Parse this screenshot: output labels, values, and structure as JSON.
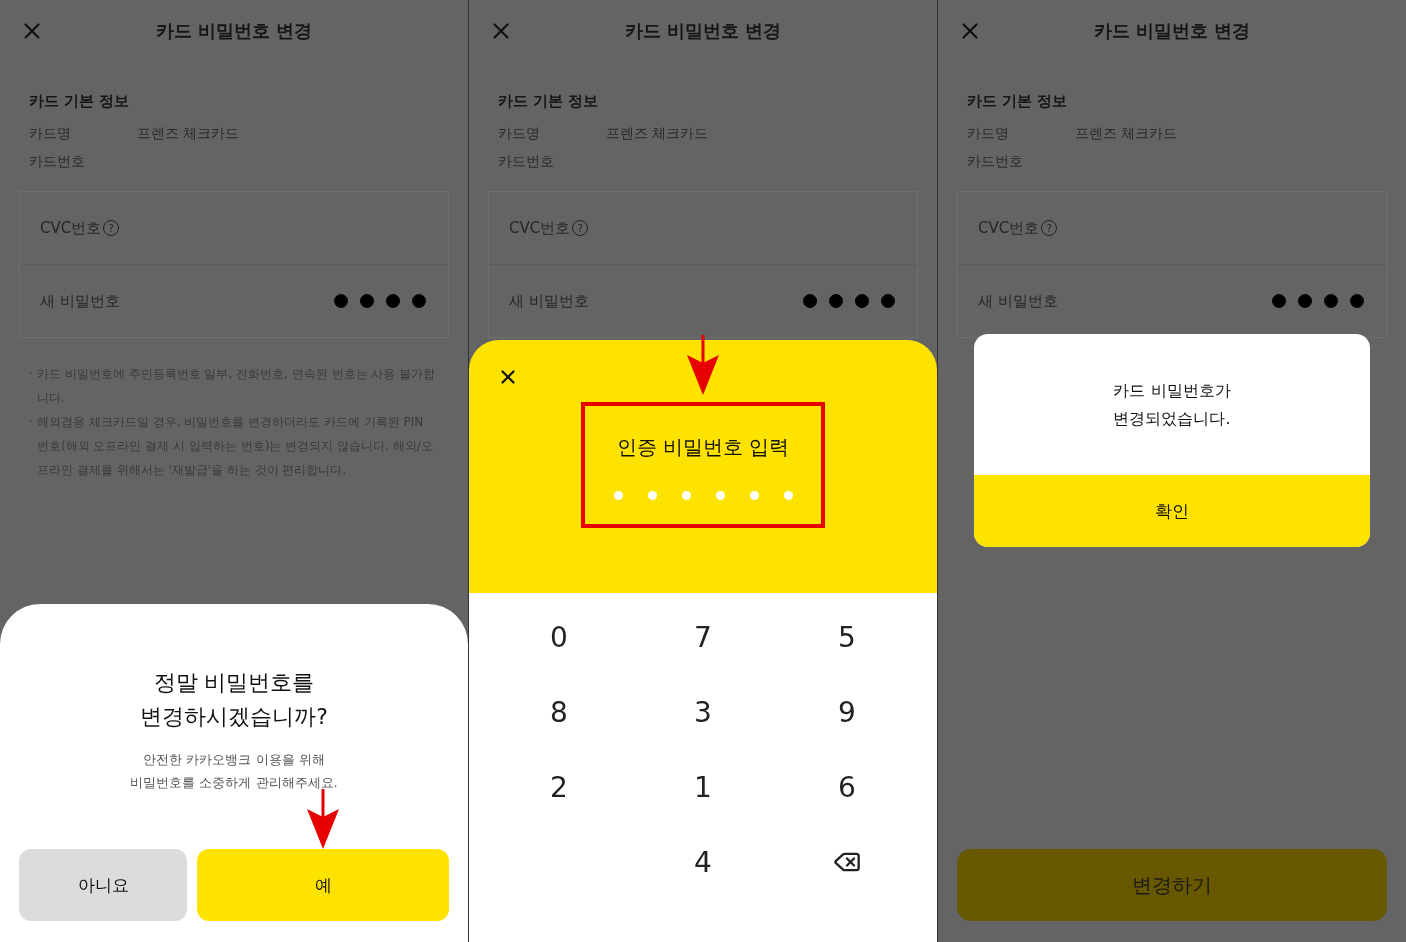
{
  "panels": [
    {
      "kind": "confirm_sheet",
      "screen": {
        "title": "카드 비밀번호 변경",
        "section_title": "카드 기본 정보",
        "info": [
          {
            "label": "카드명",
            "value": "프렌즈 체크카드"
          },
          {
            "label": "카드번호"
          }
        ],
        "cvc_label": "CVC번호",
        "help_mark": "?",
        "new_password_label": "새 비밀번호",
        "password_dots": [
          {
            "filled": true
          },
          {
            "filled": true
          },
          {
            "filled": true
          },
          {
            "filled": true
          }
        ],
        "notes": [
          {
            "bullet": "·",
            "text": "카드 비밀번호에 주민등록번호 일부, 전화번호, 연속된 번호는 사용 불가합니다."
          },
          {
            "bullet": "·",
            "text": "해외겸용 체크카드일 경우, 비밀번호를 변경하더라도 카드에 기록된 PIN 번호(해외 오프라인 결제 시 입력하는 번호)는 변경되지 않습니다. 해외/오프라인 결제를 위해서는 '재발급'을 하는 것이 편리합니다."
          }
        ]
      },
      "sheet": {
        "title": "정말 비밀번호를\n변경하시겠습니까?",
        "subtitle": "안전한 카카오뱅크 이용을 위해\n비밀번호를 소중하게 관리해주세요.",
        "pointer_arrow": true,
        "buttons": [
          {
            "label": "아니요",
            "kind": "secondary"
          },
          {
            "label": "예",
            "kind": "primary"
          }
        ]
      }
    },
    {
      "kind": "pin_pad",
      "screen": {
        "title": "카드 비밀번호 변경",
        "section_title": "카드 기본 정보",
        "info": [
          {
            "label": "카드명",
            "value": "프렌즈 체크카드"
          },
          {
            "label": "카드번호"
          }
        ],
        "cvc_label": "CVC번호",
        "help_mark": "?",
        "new_password_label": "새 비밀번호",
        "password_dots": [
          {
            "filled": true
          },
          {
            "filled": true
          },
          {
            "filled": true
          },
          {
            "filled": true
          }
        ]
      },
      "sheet": {
        "title": "인증 비밀번호 입력",
        "highlighted": true,
        "pin_dots": [
          {
            "filled": false
          },
          {
            "filled": false
          },
          {
            "filled": false
          },
          {
            "filled": false
          },
          {
            "filled": false
          },
          {
            "filled": false
          }
        ],
        "keys": [
          {
            "kind": "digit",
            "label": "0"
          },
          {
            "kind": "digit",
            "label": "7"
          },
          {
            "kind": "digit",
            "label": "5"
          },
          {
            "kind": "digit",
            "label": "8"
          },
          {
            "kind": "digit",
            "label": "3"
          },
          {
            "kind": "digit",
            "label": "9"
          },
          {
            "kind": "digit",
            "label": "2"
          },
          {
            "kind": "digit",
            "label": "1"
          },
          {
            "kind": "digit",
            "label": "6"
          },
          {
            "kind": "blank"
          },
          {
            "kind": "digit",
            "label": "4"
          },
          {
            "kind": "backspace"
          }
        ]
      }
    },
    {
      "kind": "alert",
      "screen": {
        "title": "카드 비밀번호 변경",
        "section_title": "카드 기본 정보",
        "info": [
          {
            "label": "카드명",
            "value": "프렌즈 체크카드"
          },
          {
            "label": "카드번호"
          }
        ],
        "cvc_label": "CVC번호",
        "help_mark": "?",
        "new_password_label": "새 비밀번호",
        "password_dots": [
          {
            "filled": true
          },
          {
            "filled": true
          },
          {
            "filled": true
          },
          {
            "filled": true
          }
        ],
        "submit": "변경하기"
      },
      "sheet": {
        "message": "카드 비밀번호가\n변경되었습니다.",
        "button": "확인"
      }
    }
  ]
}
